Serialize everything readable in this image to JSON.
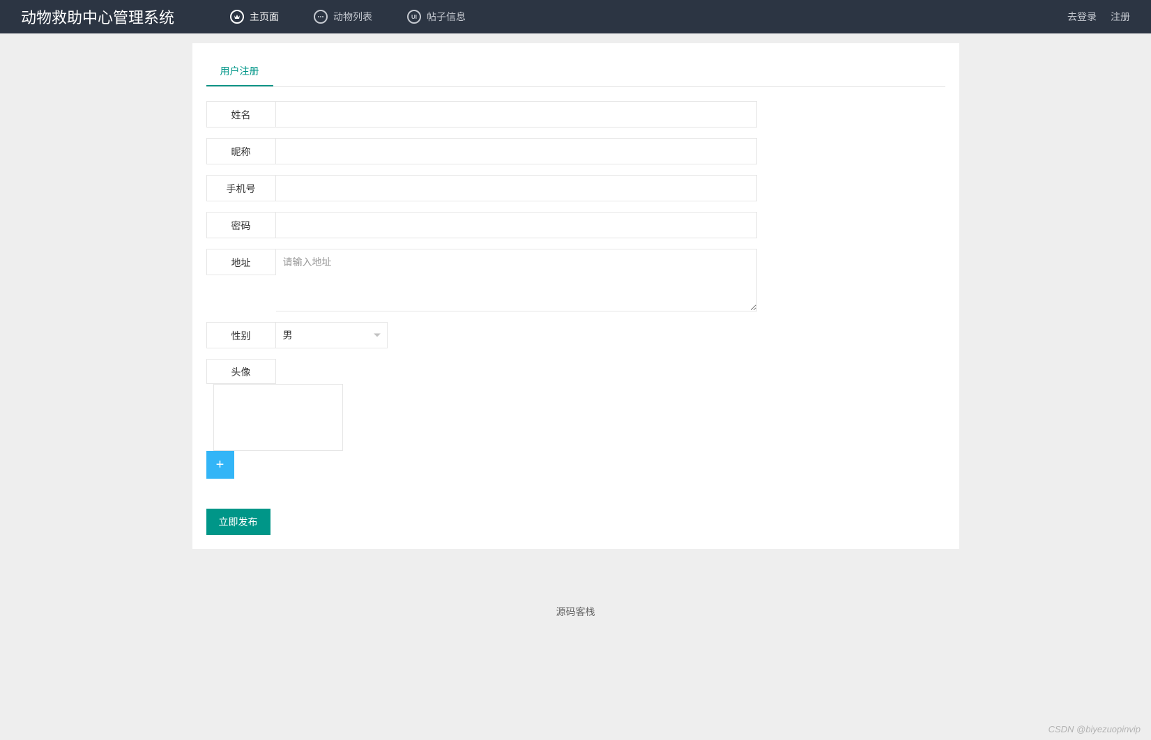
{
  "header": {
    "brand": "动物救助中心管理系统",
    "nav": [
      {
        "label": "主页面",
        "icon": "crown"
      },
      {
        "label": "动物列表",
        "icon": "dots"
      },
      {
        "label": "帖子信息",
        "icon": "ui"
      }
    ],
    "right": [
      {
        "label": "去登录"
      },
      {
        "label": "注册"
      }
    ]
  },
  "tab": {
    "title": "用户注册"
  },
  "form": {
    "name_label": "姓名",
    "nickname_label": "昵称",
    "phone_label": "手机号",
    "password_label": "密码",
    "address_label": "地址",
    "address_placeholder": "请输入地址",
    "gender_label": "性别",
    "gender_value": "男",
    "avatar_label": "头像",
    "add_label": "+",
    "submit_label": "立即发布"
  },
  "footer": {
    "text": "源码客栈"
  },
  "watermark": "CSDN @biyezuopinvip"
}
